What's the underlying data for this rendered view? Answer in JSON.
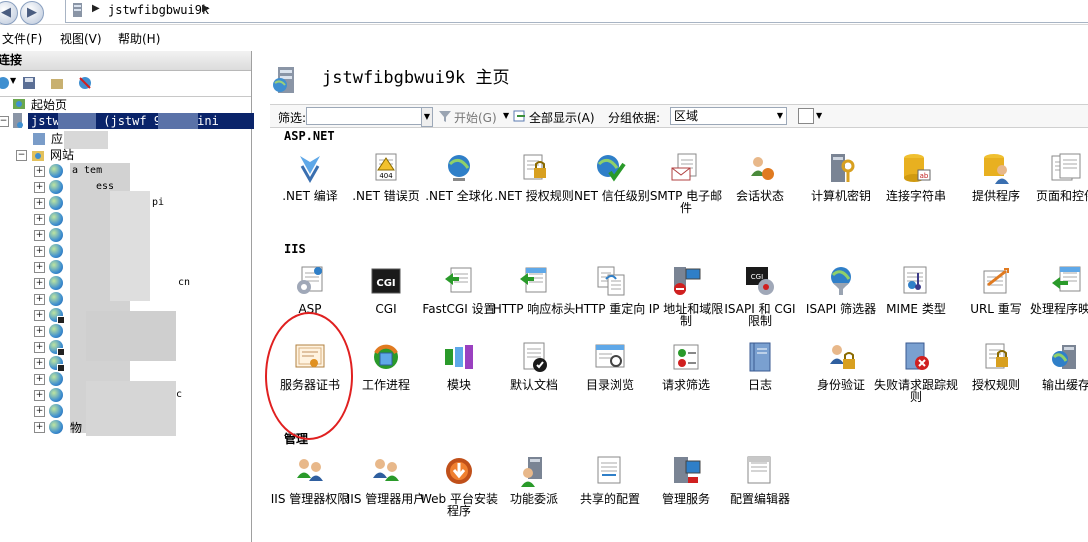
{
  "address": {
    "path": "jstwfibgbwui9k"
  },
  "menu": [
    "文件(F)",
    "视图(V)",
    "帮助(H)"
  ],
  "connections": {
    "header": "连接",
    "tree": {
      "start_page": "起始页",
      "server": "jstw      ui9k (jstwf        9k\\Admini",
      "app_pools": "应    池",
      "sites": "网站",
      "site_labels": [
        "a       tem",
        "ess",
        "pi",
        "cn",
        "c",
        "物"
      ]
    }
  },
  "main": {
    "title": "jstwfibgbwui9k 主页",
    "filterbar": {
      "label": "筛选:",
      "start": "开始(G)",
      "show_all": "全部显示(A)",
      "group_by": "分组依据:",
      "group_value": "区域"
    },
    "sections": [
      {
        "name": "ASP.NET",
        "items": [
          {
            "label": ".NET 编译",
            "icon": "net-compile-icon"
          },
          {
            "label": ".NET 错误页",
            "icon": "error-page-icon"
          },
          {
            "label": ".NET 全球化",
            "icon": "globe-icon"
          },
          {
            "label": ".NET 授权规则",
            "icon": "lock-doc-icon"
          },
          {
            "label": ".NET 信任级别",
            "icon": "check-globe-icon"
          },
          {
            "label": "SMTP 电子邮件",
            "icon": "email-icon"
          },
          {
            "label": "会话状态",
            "icon": "session-icon"
          },
          {
            "label": "计算机密钥",
            "icon": "machine-key-icon"
          },
          {
            "label": "连接字符串",
            "icon": "db-string-icon"
          },
          {
            "label": "提供程序",
            "icon": "provider-icon"
          },
          {
            "label": "页面和控件",
            "icon": "pages-icon"
          }
        ]
      },
      {
        "name": "IIS",
        "items": [
          {
            "label": "ASP",
            "icon": "asp-icon"
          },
          {
            "label": "CGI",
            "icon": "cgi-icon"
          },
          {
            "label": "FastCGI 设置",
            "icon": "fastcgi-icon"
          },
          {
            "label": "HTTP 响应标头",
            "icon": "http-header-icon"
          },
          {
            "label": "HTTP 重定向",
            "icon": "redirect-icon"
          },
          {
            "label": "IP 地址和域限制",
            "icon": "ip-restrict-icon"
          },
          {
            "label": "ISAPI 和 CGI 限制",
            "icon": "isapi-cgi-icon"
          },
          {
            "label": "ISAPI 筛选器",
            "icon": "isapi-filter-icon"
          },
          {
            "label": "MIME 类型",
            "icon": "mime-icon"
          },
          {
            "label": "URL 重写",
            "icon": "url-rewrite-icon"
          },
          {
            "label": "处理程序映射",
            "icon": "handler-icon"
          },
          {
            "label": "服务器证书",
            "icon": "certificate-icon"
          },
          {
            "label": "工作进程",
            "icon": "worker-process-icon"
          },
          {
            "label": "模块",
            "icon": "modules-icon"
          },
          {
            "label": "默认文档",
            "icon": "default-doc-icon"
          },
          {
            "label": "目录浏览",
            "icon": "dir-browse-icon"
          },
          {
            "label": "请求筛选",
            "icon": "request-filter-icon"
          },
          {
            "label": "日志",
            "icon": "logging-icon"
          },
          {
            "label": "身份验证",
            "icon": "auth-icon"
          },
          {
            "label": "失败请求跟踪规则",
            "icon": "failed-trace-icon"
          },
          {
            "label": "授权规则",
            "icon": "authz-icon"
          },
          {
            "label": "输出缓存",
            "icon": "output-cache-icon"
          }
        ]
      },
      {
        "name": "管理",
        "items": [
          {
            "label": "IIS 管理器权限",
            "icon": "mgr-perm-icon"
          },
          {
            "label": "IIS 管理器用户",
            "icon": "mgr-users-icon"
          },
          {
            "label": "Web 平台安装程序",
            "icon": "web-pi-icon"
          },
          {
            "label": "功能委派",
            "icon": "delegation-icon"
          },
          {
            "label": "共享的配置",
            "icon": "shared-config-icon"
          },
          {
            "label": "管理服务",
            "icon": "mgmt-service-icon"
          },
          {
            "label": "配置编辑器",
            "icon": "config-editor-icon"
          }
        ]
      }
    ]
  }
}
